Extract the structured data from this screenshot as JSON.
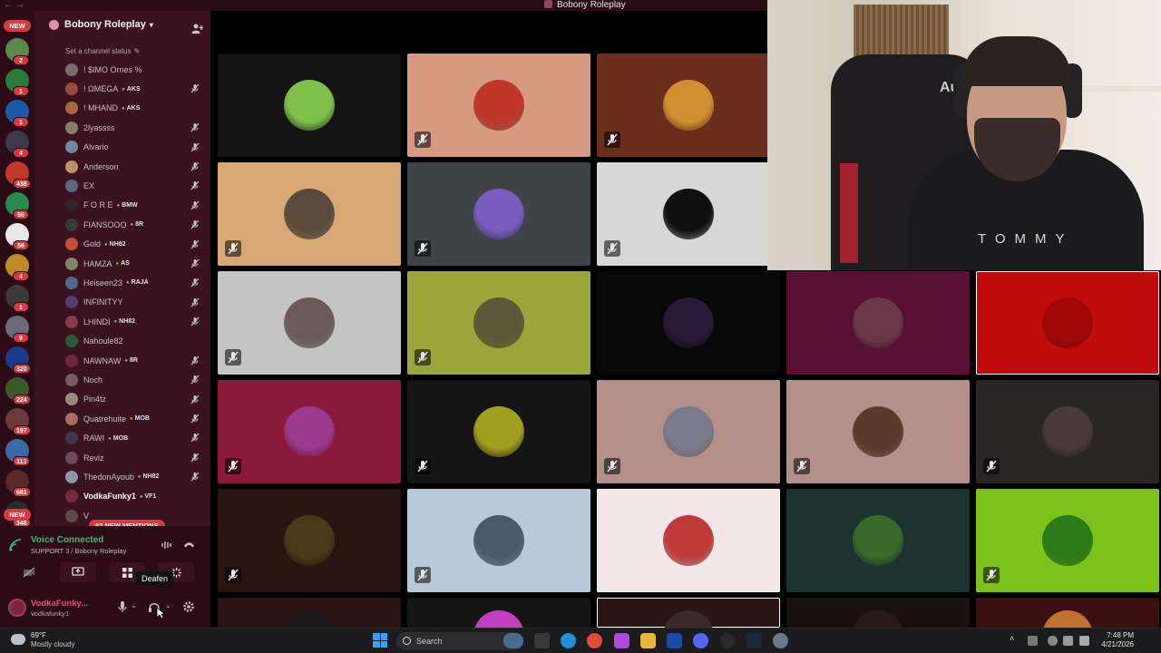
{
  "window": {
    "title": "Bobony Roleplay",
    "nav": "←  →"
  },
  "server": {
    "name": "Bobony Roleplay",
    "status_link": "Set a channel status",
    "colors": {
      "rail": "#2b0c16",
      "channel_bg": "#3a1220",
      "badge": "#d83a42",
      "voice_green": "#43b581"
    }
  },
  "rail": {
    "new_top": "NEW",
    "new_bottom": "NEW",
    "badges": [
      "2",
      "1",
      "1",
      "4",
      "438",
      "50",
      "56",
      "4",
      "1",
      "9",
      "320",
      "224",
      "197",
      "113",
      "681",
      "346"
    ]
  },
  "members": [
    {
      "name": "! $IMO Ornes %",
      "tag": "",
      "muted": false,
      "avatar": "#7a6a70"
    },
    {
      "name": "! ΩMEGA",
      "tag": "AKS",
      "muted": true,
      "avatar": "#9a4a3a"
    },
    {
      "name": "! MHAND",
      "tag": "AKS",
      "muted": false,
      "avatar": "#a36a3a"
    },
    {
      "name": "2lyassss",
      "tag": "",
      "muted": true,
      "avatar": "#8a7a6a"
    },
    {
      "name": "Alvario",
      "tag": "",
      "muted": true,
      "avatar": "#6a8aa0"
    },
    {
      "name": "Anderson",
      "tag": "",
      "muted": true,
      "avatar": "#c0906a"
    },
    {
      "name": "EX",
      "tag": "",
      "muted": true,
      "avatar": "#5a6a7a"
    },
    {
      "name": "F O R E",
      "tag": "BMW",
      "muted": true,
      "avatar": "#2a2a2a"
    },
    {
      "name": "FIANSOOO",
      "tag": "8R",
      "muted": true,
      "avatar": "#3a3a3a"
    },
    {
      "name": "Gold",
      "tag": "NH82",
      "muted": true,
      "avatar": "#c0503a"
    },
    {
      "name": "HAMZA",
      "tag": "AS",
      "muted": true,
      "avatar": "#7a8a5a"
    },
    {
      "name": "Heiseen23",
      "tag": "RAJA",
      "muted": true,
      "avatar": "#4a6a8a"
    },
    {
      "name": "INFINITYY",
      "tag": "",
      "muted": true,
      "avatar": "#5a3a6a"
    },
    {
      "name": "LHINDI",
      "tag": "NH82",
      "muted": true,
      "avatar": "#8a3a4a"
    },
    {
      "name": "Nahoule82",
      "tag": "",
      "muted": false,
      "avatar": "#2a5a3a"
    },
    {
      "name": "NAWNAW",
      "tag": "8R",
      "muted": true,
      "avatar": "#6a2a3a"
    },
    {
      "name": "Noch",
      "tag": "",
      "muted": true,
      "avatar": "#7a5a6a"
    },
    {
      "name": "Pin4tz",
      "tag": "",
      "muted": true,
      "avatar": "#9a8a7a"
    },
    {
      "name": "Quatrehuite",
      "tag": "MOB",
      "muted": true,
      "avatar": "#a07060"
    },
    {
      "name": "RAWI",
      "tag": "MOB",
      "muted": true,
      "avatar": "#3a3a4a"
    },
    {
      "name": "Reviz",
      "tag": "",
      "muted": true,
      "avatar": "#6a4a5a"
    },
    {
      "name": "ThedonAyoub",
      "tag": "NH82",
      "muted": true,
      "avatar": "#8a9aa0"
    },
    {
      "name": "VodkaFunky1",
      "tag": "VF1",
      "muted": false,
      "avatar": "#7a2840",
      "bold": true
    },
    {
      "name": "V",
      "tag": "",
      "muted": false,
      "avatar": "#5a4a4a"
    }
  ],
  "mentions_pill": "63 NEW MENTIONS",
  "voice": {
    "title": "Voice Connected",
    "subtitle": "SUPPORT 3 / Bobony Roleplay",
    "tooltip": "Deafen"
  },
  "user": {
    "display": "VodkaFunky...",
    "handle": "vodkafunky1"
  },
  "tiles": [
    {
      "bg": "#151515",
      "pic": "#7fbf4a",
      "muted": false
    },
    {
      "bg": "#d49a82",
      "pic": "#c0352a",
      "muted": true
    },
    {
      "bg": "#6a2f1c",
      "pic": "#d09030",
      "muted": true
    },
    {
      "bg": "#d7a874",
      "pic": "#5a4a3a",
      "muted": true
    },
    {
      "bg": "#3f4446",
      "pic": "#7a5cc0",
      "muted": true
    },
    {
      "bg": "#d7d7d7",
      "pic": "#101010",
      "muted": true
    },
    {
      "bg": "#c4c4c4",
      "pic": "#6a5a5a",
      "muted": true
    },
    {
      "bg": "#9aa63a",
      "pic": "#5a5a3a",
      "muted": true
    },
    {
      "bg": "#080808",
      "pic": "#2a1a3a",
      "muted": false
    },
    {
      "bg": "#5a1034",
      "pic": "#6a3a4a",
      "muted": false
    },
    {
      "bg": "#c00c0c",
      "pic": "#a00808",
      "muted": false,
      "selected": true
    },
    {
      "bg": "#8a1a3a",
      "pic": "#9a3a8a",
      "muted": true
    },
    {
      "bg": "#151515",
      "pic": "#a0a020",
      "muted": true
    },
    {
      "bg": "#b39089",
      "pic": "#7a7a8a",
      "muted": true
    },
    {
      "bg": "#b39089",
      "pic": "#5a3a2a",
      "muted": true
    },
    {
      "bg": "#2a2626",
      "pic": "#4a3a3a",
      "muted": true
    },
    {
      "bg": "#2a1410",
      "pic": "#4a3a1a",
      "muted": true
    },
    {
      "bg": "#b8cad8",
      "pic": "#4a5a6a",
      "muted": true
    },
    {
      "bg": "#f3e6e6",
      "pic": "#c03a3a",
      "muted": false,
      "selected": true
    },
    {
      "bg": "#1c3330",
      "pic": "#3a6a2a",
      "muted": false
    },
    {
      "bg": "#7cc21a",
      "pic": "#2a7a1a",
      "muted": true
    },
    {
      "bg": "#2a1414",
      "pic": "#1a1a1a",
      "muted": false
    },
    {
      "bg": "#151515",
      "pic": "#c040c0",
      "muted": false
    },
    {
      "bg": "#2a1616",
      "pic": "#3a2a2a",
      "muted": false,
      "selected": true
    },
    {
      "bg": "#1a1010",
      "pic": "#2a1a1a",
      "muted": false
    },
    {
      "bg": "#3a1010",
      "pic": "#c07030",
      "muted": false
    }
  ],
  "webcam": {
    "chair_brand": "AutoF",
    "shirt_text": "TOMMY"
  },
  "taskbar": {
    "temp": "69°F",
    "condition": "Mostly cloudy",
    "search": "Search",
    "time": "7:48 PM",
    "date": "4/21/2026"
  }
}
